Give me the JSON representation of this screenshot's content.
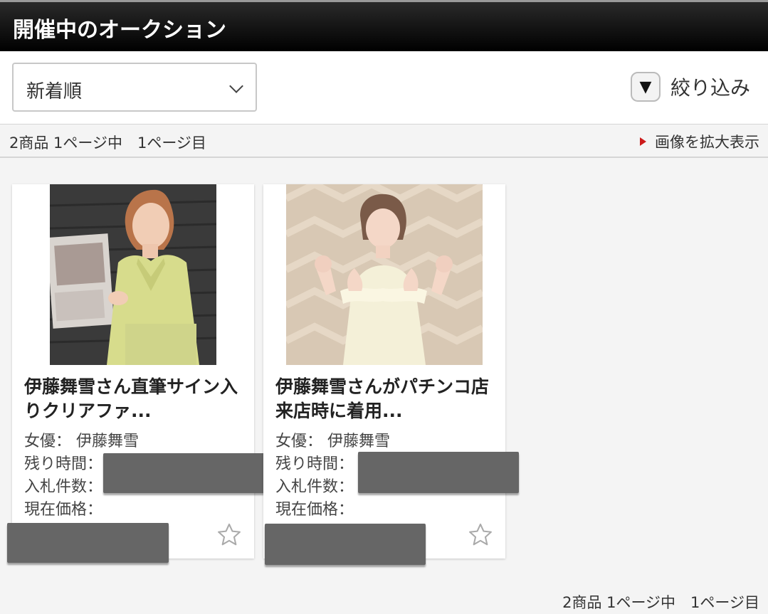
{
  "header": {
    "title": "開催中のオークション"
  },
  "controls": {
    "sort_value": "新着順",
    "filter_label": "絞り込み",
    "filter_icon": "▼"
  },
  "pager": {
    "summary": "2商品 1ページ中　1ページ目",
    "enlarge_label": "画像を拡大表示"
  },
  "items": [
    {
      "title": "伊藤舞雪さん直筆サイン入りクリアファ...",
      "actress_label": "女優：",
      "actress": "伊藤舞雪",
      "remaining_label": "残り時間：",
      "bids_label": "入札件数：",
      "price_label": "現在価格："
    },
    {
      "title": "伊藤舞雪さんがパチンコ店来店時に着用...",
      "actress_label": "女優：",
      "actress": "伊藤舞雪",
      "remaining_label": "残り時間：",
      "bids_label": "入札件数：",
      "price_label": "現在価格："
    }
  ],
  "footer": {
    "summary": "2商品 1ページ中　1ページ目"
  },
  "colors": {
    "header_bg": "#000000",
    "accent": "#cc1a1a",
    "redaction": "#666666"
  }
}
